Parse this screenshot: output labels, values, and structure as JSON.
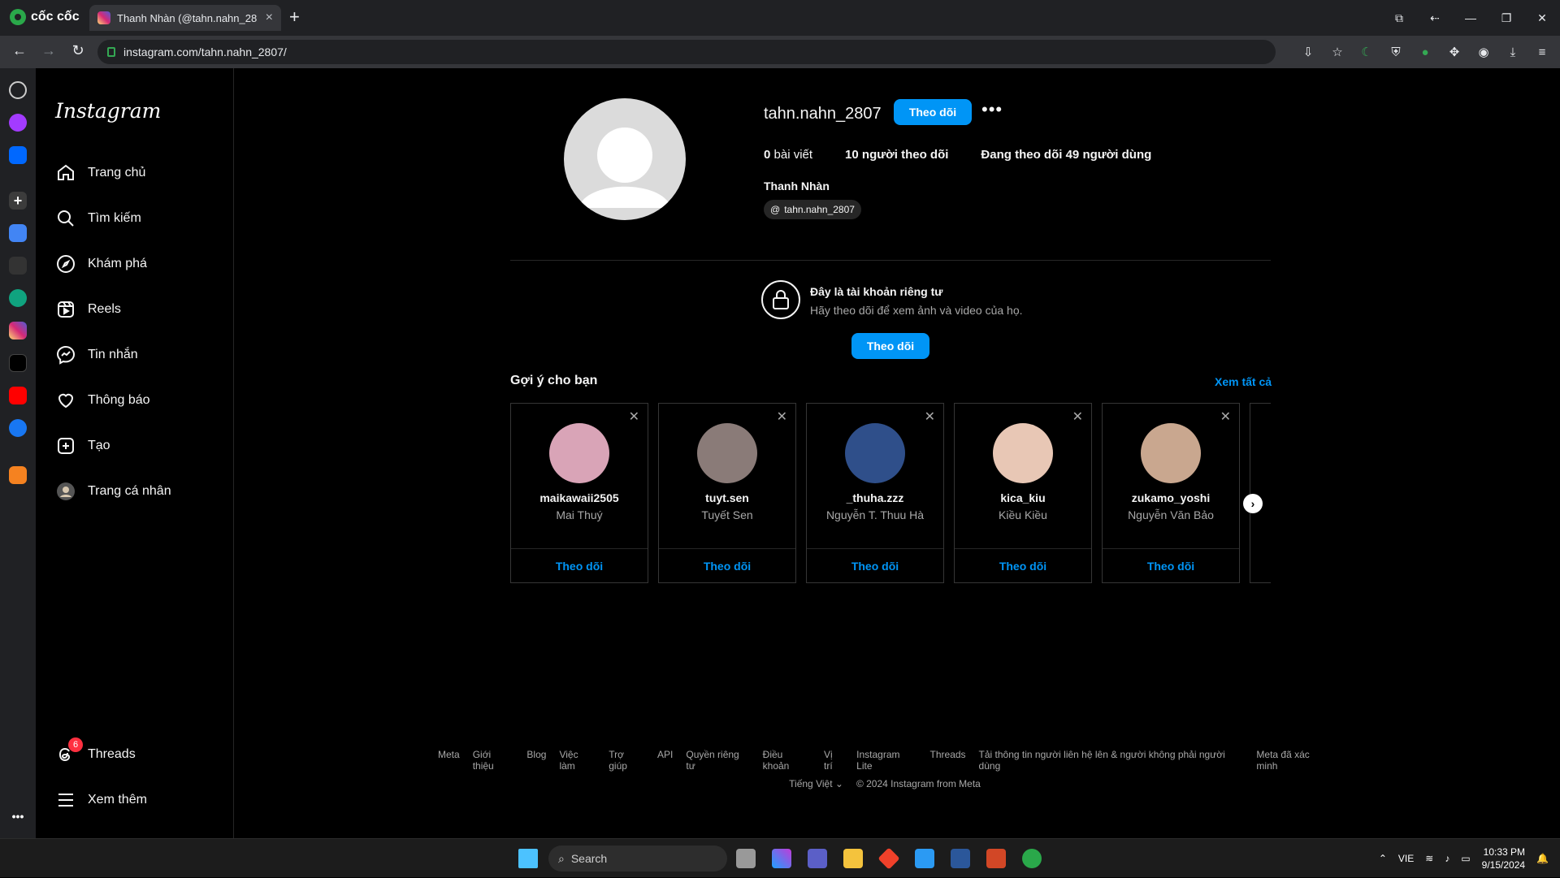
{
  "browser": {
    "brand": "cốc cốc",
    "tab_title": "Thanh Nhàn (@tahn.nahn_28",
    "url": "instagram.com/tahn.nahn_2807/"
  },
  "ig": {
    "logo": "Instagram",
    "nav": [
      {
        "label": "Trang chủ",
        "icon": "home-icon"
      },
      {
        "label": "Tìm kiếm",
        "icon": "search-icon"
      },
      {
        "label": "Khám phá",
        "icon": "compass-icon"
      },
      {
        "label": "Reels",
        "icon": "reels-icon"
      },
      {
        "label": "Tin nhắn",
        "icon": "messenger-icon"
      },
      {
        "label": "Thông báo",
        "icon": "heart-icon"
      },
      {
        "label": "Tạo",
        "icon": "create-icon"
      },
      {
        "label": "Trang cá nhân",
        "icon": "profile-avatar-icon"
      }
    ],
    "threads": {
      "label": "Threads",
      "badge": "6"
    },
    "more": "Xem thêm"
  },
  "profile": {
    "username": "tahn.nahn_2807",
    "follow_label": "Theo dõi",
    "more_label": "•••",
    "posts_count": "0",
    "posts_label": "bài viết",
    "followers_count": "10",
    "followers_label": "người theo dõi",
    "following_prefix": "Đang theo dõi",
    "following_count": "49",
    "following_suffix": "người dùng",
    "full_name": "Thanh Nhàn",
    "threads_tag": "tahn.nahn_2807"
  },
  "private": {
    "title": "Đây là tài khoản riêng tư",
    "subtitle": "Hãy theo dõi để xem ảnh và video của họ.",
    "follow_label": "Theo dõi"
  },
  "suggestions": {
    "title": "Gợi ý cho bạn",
    "see_all": "Xem tất cả",
    "follow_label": "Theo dõi",
    "items": [
      {
        "username": "maikawaii2505",
        "name": "Mai Thuý",
        "color": "#d9a4b7"
      },
      {
        "username": "tuyt.sen",
        "name": "Tuyết Sen",
        "color": "#8a7b78"
      },
      {
        "username": "_thuha.zzz",
        "name": "Nguyễn T. Thuu Hà",
        "color": "#2f4f8a"
      },
      {
        "username": "kica_kiu",
        "name": "Kiều Kiều",
        "color": "#e8c7b5"
      },
      {
        "username": "zukamo_yoshi",
        "name": "Nguyễn Văn Bảo",
        "color": "#c9a78f"
      }
    ]
  },
  "footer": {
    "links": [
      "Meta",
      "Giới thiệu",
      "Blog",
      "Việc làm",
      "Trợ giúp",
      "API",
      "Quyền riêng tư",
      "Điều khoản",
      "Vị trí",
      "Instagram Lite",
      "Threads",
      "Tải thông tin người liên hệ lên & người không phải người dùng",
      "Meta đã xác minh"
    ],
    "language": "Tiếng Việt",
    "copyright": "© 2024 Instagram from Meta"
  },
  "taskbar": {
    "search_placeholder": "Search",
    "lang": "VIE",
    "time": "10:33 PM",
    "date": "9/15/2024"
  }
}
